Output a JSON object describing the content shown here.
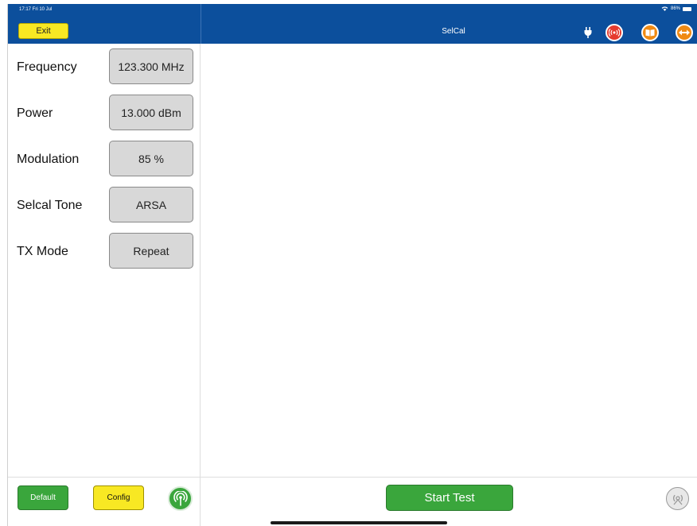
{
  "status_bar": {
    "time": "17:17  Fri 10 Jul",
    "battery": "86%"
  },
  "header": {
    "exit_label": "Exit",
    "title": "SelCal",
    "icons": [
      "plug-icon",
      "radio-signal-icon",
      "book-icon",
      "arrows-icon"
    ],
    "colors": {
      "bar": "#0c4f9c",
      "exit": "#f8e823",
      "signal": "#e53b2e",
      "orange": "#f08a13"
    }
  },
  "params": [
    {
      "label": "Frequency",
      "value": "123.300 MHz"
    },
    {
      "label": "Power",
      "value": "13.000 dBm"
    },
    {
      "label": "Modulation",
      "value": "85 %"
    },
    {
      "label": "Selcal Tone",
      "value": "ARSA"
    },
    {
      "label": "TX Mode",
      "value": "Repeat"
    }
  ],
  "footer": {
    "default_label": "Default",
    "config_label": "Config",
    "start_label": "Start Test",
    "icons": [
      "antenna-icon",
      "transmit-status-icon"
    ],
    "colors": {
      "green": "#3aa63c",
      "yellow": "#f8e823"
    }
  }
}
